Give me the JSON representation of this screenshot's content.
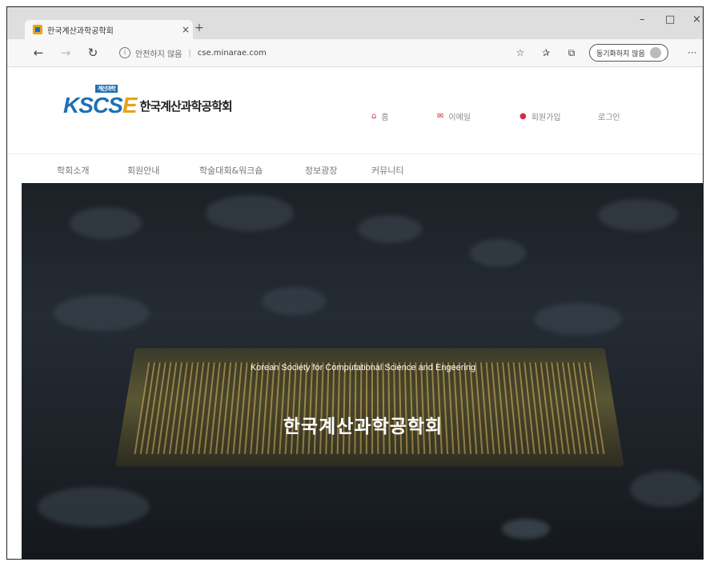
{
  "browser": {
    "tab_title": "한국계산과학공학회",
    "tab_close": "×",
    "new_tab": "+",
    "address_info": "안전하지 않음",
    "url": "cse.minarae.com",
    "sync_button": "동기화하지 않음",
    "win_minimize": "–",
    "win_maximize": "□",
    "win_close": "×",
    "more": "···",
    "back": "←",
    "forward": "→",
    "reload": "↻",
    "info_icon": "i",
    "separator": "|",
    "fav_star": "☆",
    "favorites": "✰",
    "collections": "⧉"
  },
  "site": {
    "logo_badge": "계산과학",
    "logo_k": "K",
    "logo_cs": "SCS",
    "logo_e": "E",
    "logo_name": "한국계산과학공학회",
    "top_links": [
      {
        "label": "홈",
        "icon": "home-icon",
        "glyph": "⌂"
      },
      {
        "label": "이메일",
        "icon": "mail-icon",
        "glyph": "✉"
      },
      {
        "label": "회원가입",
        "icon": "user-icon",
        "glyph": "●"
      },
      {
        "label": "로그인",
        "icon": "",
        "glyph": ""
      }
    ],
    "main_nav": [
      "학회소개",
      "회원안내",
      "학술대회&워크숍",
      "정보광장",
      "커뮤니티"
    ]
  },
  "hero": {
    "subtitle": "Korean Society for Computational Science and Engeering",
    "headline": "한국계산과학공학회"
  },
  "colors": {
    "brand_blue": "#1f6fb5",
    "brand_orange": "#e8a317",
    "icon_red": "#d52b3c"
  }
}
